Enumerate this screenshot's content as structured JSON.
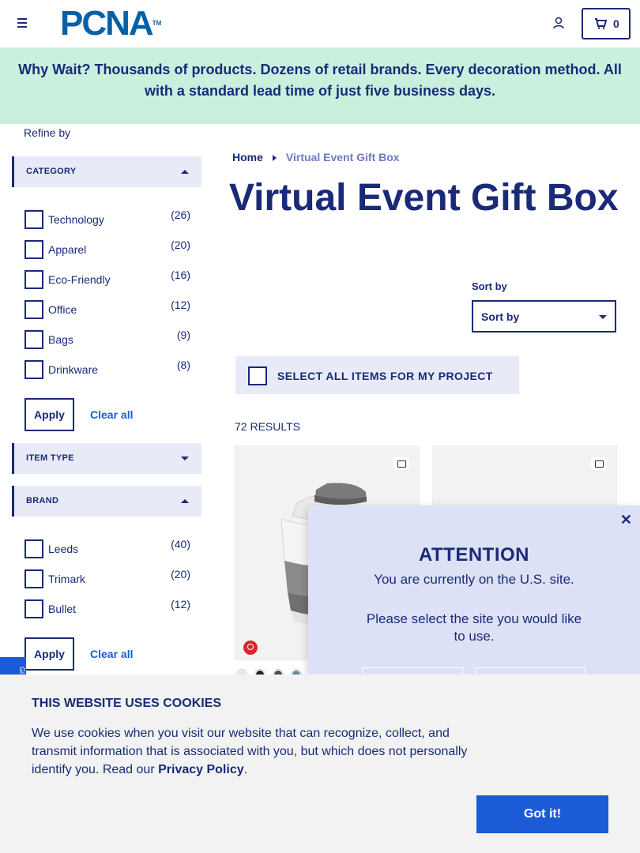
{
  "header": {
    "logo_text": "PCNA",
    "logo_tm": "TM",
    "cart_count": "0"
  },
  "banner": {
    "text": "Why Wait? Thousands of products. Dozens of retail brands. Every decoration method. All with a standard lead time of just five business days."
  },
  "sidebar": {
    "refine_label": "Refine by",
    "category": {
      "label": "CATEGORY",
      "options": [
        {
          "name": "Technology",
          "count": "(26)"
        },
        {
          "name": "Apparel",
          "count": "(20)"
        },
        {
          "name": "Eco-Friendly",
          "count": "(16)"
        },
        {
          "name": "Office",
          "count": "(12)"
        },
        {
          "name": "Bags",
          "count": "(9)"
        },
        {
          "name": "Drinkware",
          "count": "(8)"
        }
      ],
      "apply_label": "Apply",
      "clear_label": "Clear all"
    },
    "item_type": {
      "label": "ITEM TYPE"
    },
    "brand": {
      "label": "BRAND",
      "options": [
        {
          "name": "Leeds",
          "count": "(40)"
        },
        {
          "name": "Trimark",
          "count": "(20)"
        },
        {
          "name": "Bullet",
          "count": "(12)"
        }
      ],
      "apply_label": "Apply",
      "clear_label": "Clear all"
    },
    "side_tab_text": "Gi"
  },
  "breadcrumb": {
    "home": "Home",
    "current": "Virtual Event Gift Box"
  },
  "page_title": "Virtual Event Gift Box",
  "sort": {
    "label": "Sort by",
    "value": "Sort by"
  },
  "select_all_label": "SELECT ALL ITEMS FOR MY PROJECT",
  "results_text": "72 RESULTS",
  "product_1": {
    "swatches": [
      "#e6e6e6",
      "#222222",
      "#444b55",
      "#6b8aa0"
    ]
  },
  "attention": {
    "title": "ATTENTION",
    "line1": "You are currently on the U.S. site.",
    "line2": "Please select the site you would like to use."
  },
  "cookie": {
    "title": "THIS WEBSITE USES COOKIES",
    "text_before": "We use cookies when you visit our website that can recognize, collect, and transmit information that is associated with you, but which does not personally identify you. Read our ",
    "link": "Privacy Policy",
    "text_after": ".",
    "button": "Got it!"
  }
}
